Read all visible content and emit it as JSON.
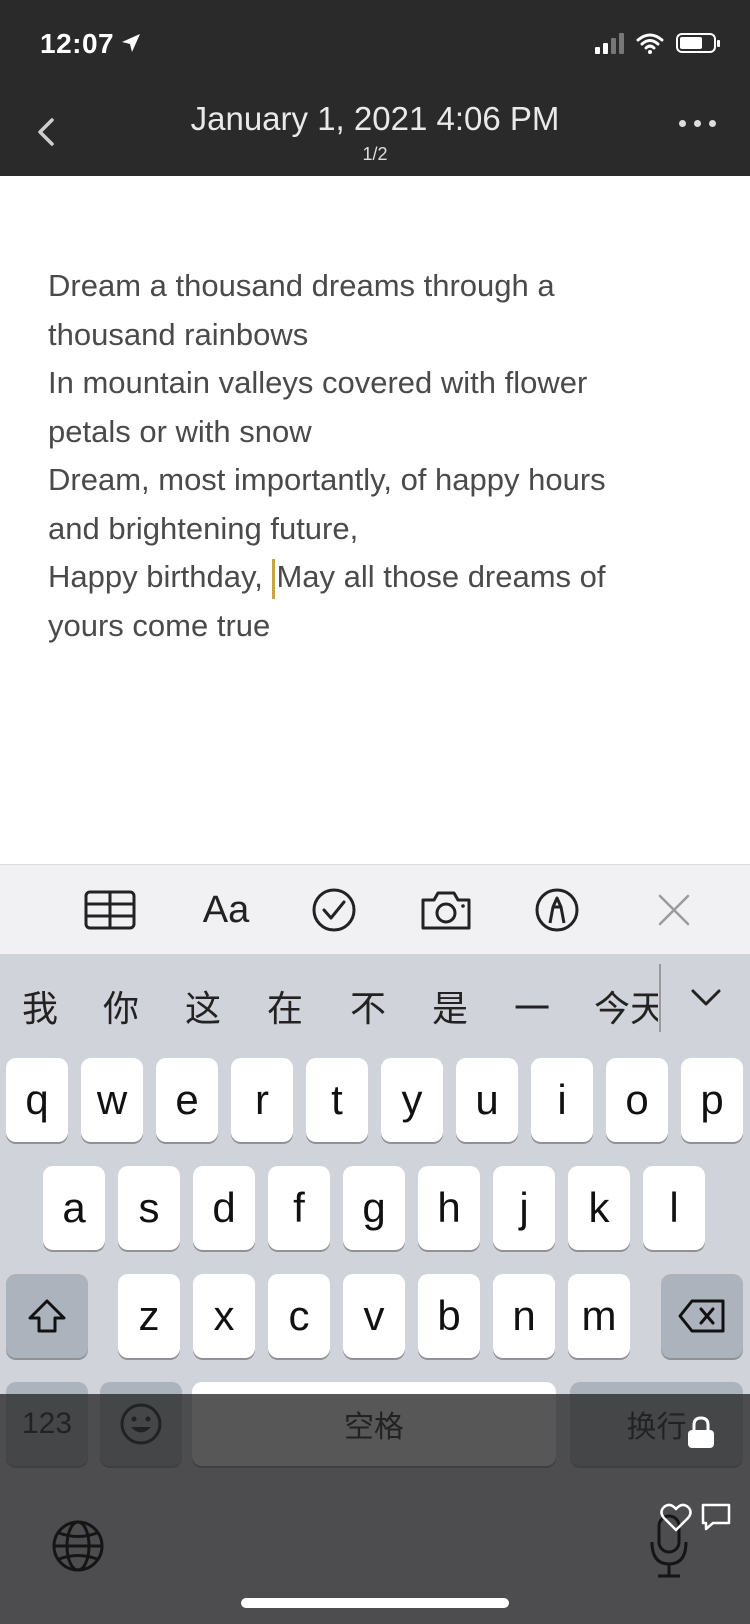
{
  "status_bar": {
    "time": "12:07"
  },
  "nav": {
    "title": "January 1, 2021 4:06 PM",
    "page_indicator": "1/2"
  },
  "note": {
    "lines": [
      "Dream a thousand dreams through a",
      "thousand rainbows",
      "In mountain valleys covered with flower",
      "petals or with snow",
      "Dream, most importantly, of happy hours",
      "and brightening future,",
      "Happy birthday, ",
      "May all those dreams of",
      "yours come true"
    ]
  },
  "toolbar": {
    "items": [
      "table-icon",
      "Aa",
      "checklist-icon",
      "camera-icon",
      "markup-icon",
      "close-icon"
    ]
  },
  "keyboard": {
    "candidates": [
      "我",
      "你",
      "这",
      "在",
      "不",
      "是",
      "一",
      "今天"
    ],
    "row1": [
      "q",
      "w",
      "e",
      "r",
      "t",
      "y",
      "u",
      "i",
      "o",
      "p"
    ],
    "row2": [
      "a",
      "s",
      "d",
      "f",
      "g",
      "h",
      "j",
      "k",
      "l"
    ],
    "row3": [
      "z",
      "x",
      "c",
      "v",
      "b",
      "n",
      "m"
    ],
    "numbers_label": "123",
    "space_label": "空格",
    "return_label": "换行"
  },
  "colors": {
    "header_bg": "#2a2a2a",
    "caret": "#c9a24a",
    "keyboard_bg": "#d0d3d9"
  }
}
